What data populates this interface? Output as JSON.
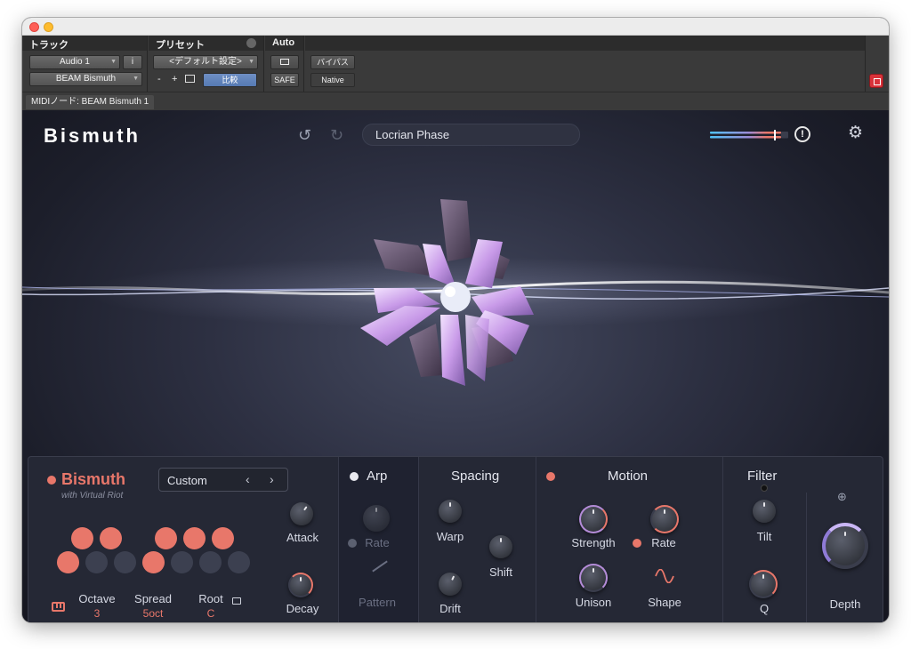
{
  "host": {
    "sections": {
      "track_header": "トラック",
      "preset_header": "プリセット",
      "auto_header": "Auto"
    },
    "track": {
      "name": "Audio 1",
      "info_button": "i",
      "plugin": "BEAM Bismuth"
    },
    "preset": {
      "current": "<デフォルト設定>",
      "minus": "-",
      "plus": "+",
      "compare": "比較"
    },
    "auto": {
      "safe": "SAFE"
    },
    "bypass": "バイパス",
    "native": "Native",
    "midi_node": "MIDIノード: BEAM Bismuth 1"
  },
  "plugin": {
    "title": "Bismuth",
    "preset_name": "Locrian Phase",
    "alert": "!"
  },
  "panel": {
    "brand": "Bismuth",
    "subtitle": "with Virtual Riot",
    "mode": {
      "value": "Custom",
      "prev": "‹",
      "next": "›"
    },
    "pads_row1": [
      true,
      true,
      false,
      true,
      true,
      true
    ],
    "pads_row2": [
      true,
      false,
      false,
      true,
      false,
      false,
      false
    ],
    "octave": {
      "label": "Octave",
      "value": "3"
    },
    "spread": {
      "label": "Spread",
      "value": "5oct"
    },
    "root": {
      "label": "Root",
      "value": "C"
    },
    "attack": "Attack",
    "decay": "Decay",
    "arp": {
      "title": "Arp",
      "rate": "Rate",
      "pattern": "Pattern"
    },
    "spacing": {
      "title": "Spacing",
      "warp": "Warp",
      "shift": "Shift",
      "drift": "Drift"
    },
    "motion": {
      "title": "Motion",
      "strength": "Strength",
      "rate": "Rate",
      "unison": "Unison",
      "shape": "Shape"
    },
    "filter": {
      "title": "Filter",
      "tilt": "Tilt",
      "q": "Q"
    },
    "depth": "Depth"
  },
  "colors": {
    "accent": "#e8776a",
    "pad_off": "#3c4050",
    "brand": "#e8776a"
  }
}
